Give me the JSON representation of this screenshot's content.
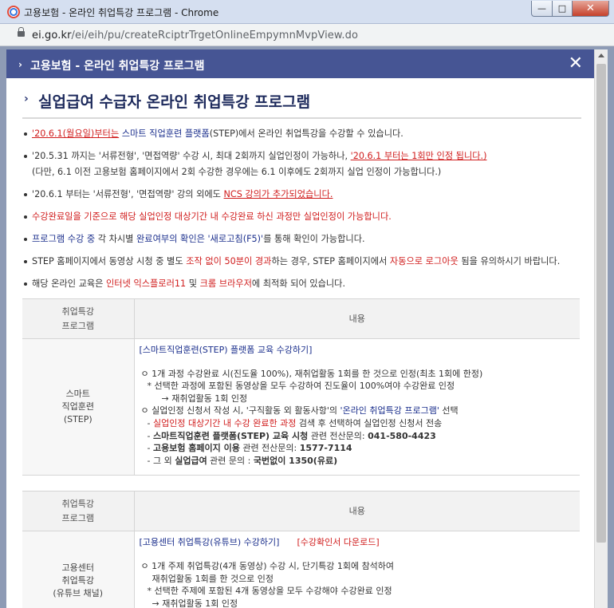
{
  "window": {
    "title": "고용보험 - 온라인 취업특강 프로그램 - Chrome",
    "url_host": "ei.go.kr",
    "url_path": "/ei/eih/pu/createRciptrTrgetOnlineEmpymnMvpView.do",
    "minimize": "—",
    "maximize": "□",
    "close": "✕"
  },
  "modal": {
    "header_title": "고용보험 - 온라인 취업특강 프로그램",
    "close_label": "✕",
    "section_title": "실업급여 수급자 온라인 취업특강 프로그램"
  },
  "notes": [
    {
      "a": "'20.6.1(월요일)부터는",
      "b": " 스마트 직업훈련 플랫폼",
      "c": "(STEP)에서 온라인 취업특강을 수강할 수 있습니다."
    },
    {
      "a": "'20.5.31 까지는 '서류전형', '면접역량' 수강 시, 최대 2회까지 실업인정이 가능하나, ",
      "b": "'20.6.1 부터는 1회만 인정 됩니다.)",
      "c": "(다만, 6.1 이전 고용보험 홈페이지에서 2회 수강한 경우에는 6.1 이후에도 2회까지 실업 인정이 가능합니다.)"
    },
    {
      "a": "'20.6.1 부터는 '서류전형', '면접역량' 강의 외에도 ",
      "b": "NCS 강의가 추가되었습니다."
    },
    {
      "a": "수강완료일을 기준으로 해당 실업인정 대상기간 내 수강완료 하신 과정만 실업인정이 가능합니다."
    },
    {
      "a": "프로그램 수강 중",
      "b": " 각 차시별 ",
      "c": "완료여부의 확인은",
      "d": " '새로고침(F5)'",
      "e": "를 통해 확인이 가능합니다."
    },
    {
      "a": "STEP 홈페이지에서 동영상 시청 중 별도 ",
      "b": "조작 없이 50분이 경과",
      "c": "하는 경우, STEP 홈페이지에서 ",
      "d": "자동으로 로그아웃",
      "e": " 됨을 유의하시기 바랍니다."
    },
    {
      "a": "해당 온라인 교육은 ",
      "b": "인터넷 익스플로러11",
      "c": " 및 ",
      "d": "크롬 브라우저",
      "e": "에 최적화 되어 있습니다."
    }
  ],
  "table1": {
    "th_left": "취업특강\n프로그램",
    "th_right": "내용",
    "left_cell": "스마트\n직업훈련\n(STEP)",
    "link": "[스마트직업훈련(STEP) 플랫폼 교육 수강하기]",
    "l1": "ㅇ 1개 과정 수강완료 시(진도율 100%), 재취업활동 1회를 한 것으로 인정(최초 1회에 한정)",
    "l2": "* 선택한 과정에 포함된 동영상을 모두 수강하여 진도율이 100%여야 수강완료 인정",
    "l3": "→ 재취업활동 1회 인정",
    "l4a": "ㅇ 실업인정 신청서 작성 시, '구직활동 외 활동사항'의 ",
    "l4b": "'온라인 취업특강 프로그램'",
    "l4c": " 선택",
    "l5a": "- ",
    "l5b": "실업인정 대상기간 내 수강 완료한 과정",
    "l5c": " 검색 후 선택하여 실업인정 신청서 전송",
    "l6a": "- ",
    "l6b": "스마트직업훈련 플랫폼(STEP) 교육 시청",
    "l6c": " 관련 전산문의: ",
    "l6d": "041-580-4423",
    "l7a": "- ",
    "l7b": "고용보험 홈페이지 이용",
    "l7c": " 관련 전산문의: ",
    "l7d": "1577-7114",
    "l8a": "- 그 외 ",
    "l8b": "실업급여",
    "l8c": " 관련 문의 : ",
    "l8d": "국번없이 1350(유료)"
  },
  "table2": {
    "th_left": "취업특강\n프로그램",
    "th_right": "내용",
    "left_cell": "고용센터\n취업특강\n(유튜브 채널)",
    "link": "[고용센터 취업특강(유튜브) 수강하기]",
    "download": "[수강확인서 다운로드]",
    "l1": "ㅇ 1개 주제 취업특강(4개 동영상) 수강 시, 단기특강 1회에 참석하여",
    "l2": "재취업활동 1회를 한 것으로 인정",
    "l3": "* 선택한 주제에 포함된 4개 동영상을 모두 수강해야 수강완료 인정",
    "l4": "→ 재취업활동 1회 인정"
  }
}
